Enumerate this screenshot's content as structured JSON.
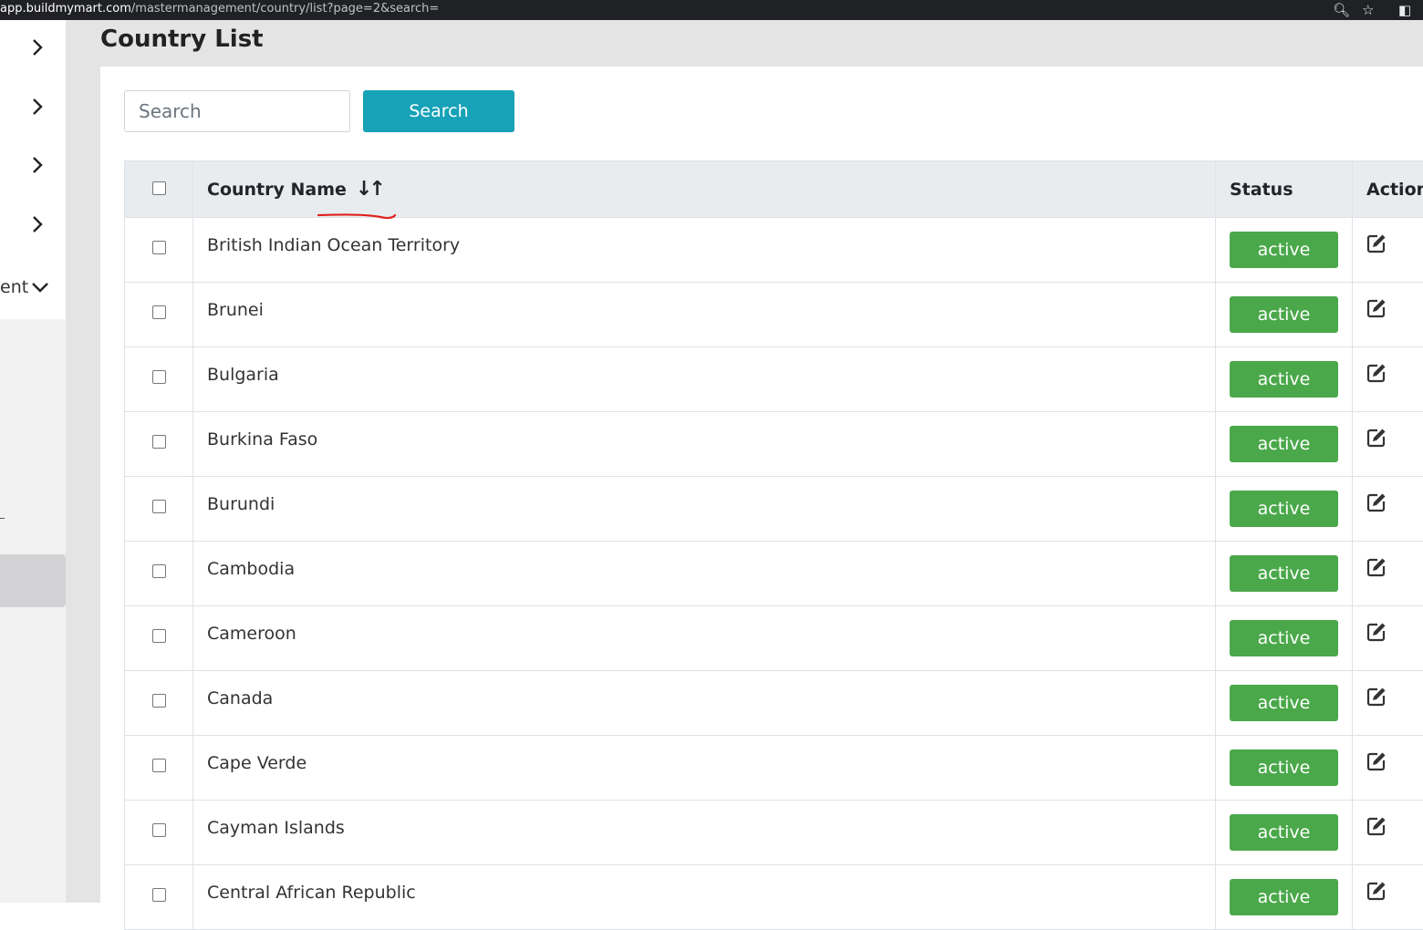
{
  "browser": {
    "url_host": "app.buildmymart.com",
    "url_path": "/mastermanagement/country/list?page=2&search="
  },
  "sidebar": {
    "partial_label": "ent"
  },
  "page": {
    "title": "Country List"
  },
  "search": {
    "placeholder": "Search",
    "button_label": "Search"
  },
  "table": {
    "headers": {
      "name": "Country Name",
      "sort_glyph": "↓↑",
      "status": "Status",
      "action": "Action"
    },
    "rows": [
      {
        "name": "British Indian Ocean Territory",
        "status": "active"
      },
      {
        "name": "Brunei",
        "status": "active"
      },
      {
        "name": "Bulgaria",
        "status": "active"
      },
      {
        "name": "Burkina Faso",
        "status": "active"
      },
      {
        "name": "Burundi",
        "status": "active"
      },
      {
        "name": "Cambodia",
        "status": "active"
      },
      {
        "name": "Cameroon",
        "status": "active"
      },
      {
        "name": "Canada",
        "status": "active"
      },
      {
        "name": "Cape Verde",
        "status": "active"
      },
      {
        "name": "Cayman Islands",
        "status": "active"
      },
      {
        "name": "Central African Republic",
        "status": "active"
      }
    ]
  },
  "colors": {
    "primary_button": "#17a2b8",
    "status_active": "#4aa84a",
    "annotation": "#e0221f"
  }
}
